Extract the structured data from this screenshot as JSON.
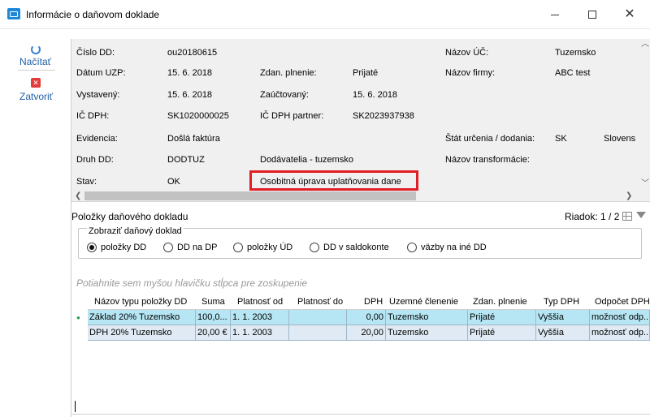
{
  "window": {
    "title": "Informácie o daňovom doklade"
  },
  "toolbar": {
    "load_label": "Načítať",
    "close_label": "Zatvoriť"
  },
  "header": {
    "cislo_dd_label": "Číslo DD:",
    "cislo_dd_value": "ou20180615",
    "nazov_uc_label": "Názov ÚČ:",
    "nazov_uc_value": "Tuzemsko",
    "datum_uzp_label": "Dátum UZP:",
    "datum_uzp_value": "15. 6. 2018",
    "zdan_plnenie_label": "Zdan. plnenie:",
    "zdan_plnenie_value": "Prijaté",
    "nazov_firmy_label": "Názov firmy:",
    "nazov_firmy_value": "ABC test",
    "vystaveny_label": "Vystavený:",
    "vystaveny_value": "15. 6. 2018",
    "zauctovany_label": "Zaúčtovaný:",
    "zauctovany_value": "15. 6. 2018",
    "ic_dph_label": "IČ DPH:",
    "ic_dph_value": "SK1020000025",
    "ic_dph_partner_label": "IČ DPH partner:",
    "ic_dph_partner_value": "SK2023937938",
    "evidencia_label": "Evidencia:",
    "evidencia_value": "Došlá faktúra",
    "stat_urcenia_label": "Štát určenia / dodania:",
    "stat_urcenia_code": "SK",
    "stat_urcenia_name": "Slovens",
    "druh_dd_label": "Druh DD:",
    "druh_dd_value": "DODTUZ",
    "dodavatelia_value": "Dodávatelia - tuzemsko",
    "nazov_transformacie_label": "Názov transformácie:",
    "stav_label": "Stav:",
    "stav_value": "OK",
    "osobitna_uprava_value": "Osobitná úprava uplatňovania dane"
  },
  "items": {
    "section_title": "Položky daňového dokladu",
    "row_count": "Riadok: 1 / 2",
    "group_title": "Zobraziť daňový doklad",
    "radios": [
      {
        "label": "položky DD",
        "checked": true
      },
      {
        "label": "DD na DP",
        "checked": false
      },
      {
        "label": "položky ÚD",
        "checked": false
      },
      {
        "label": "DD v saldokonte",
        "checked": false
      },
      {
        "label": "väzby na iné DD",
        "checked": false
      }
    ],
    "drag_hint": "Potiahnite sem myšou hlavičku stĺpca pre zoskupenie",
    "columns": [
      "Názov typu položky DD",
      "Suma",
      "Platnosť od",
      "Platnosť do",
      "DPH",
      "Územné členenie",
      "Zdan. plnenie",
      "Typ DPH",
      "Odpočet DPH"
    ],
    "rows": [
      [
        "Základ 20% Tuzemsko",
        "100,0...",
        "1. 1. 2003",
        "",
        "0,00",
        "Tuzemsko",
        "Prijaté",
        "Vyššia",
        "možnosť odp..."
      ],
      [
        "DPH 20% Tuzemsko",
        "20,00 €",
        "1. 1. 2003",
        "",
        "20,00",
        "Tuzemsko",
        "Prijaté",
        "Vyššia",
        "možnosť odp..."
      ]
    ]
  },
  "colors": {
    "highlight_border": "#e01e24",
    "selected_row": "#b6e6f4",
    "alt_row": "#dfeaf4"
  }
}
